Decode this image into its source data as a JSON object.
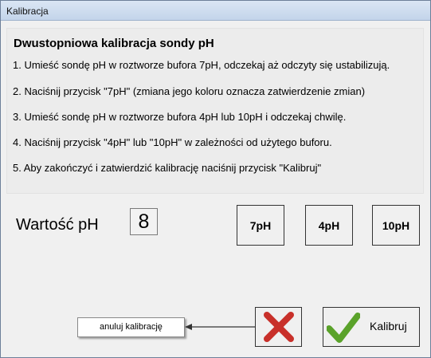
{
  "window": {
    "title": "Kalibracja"
  },
  "instructions": {
    "heading": "Dwustopniowa kalibracja sondy pH",
    "steps": [
      "1. Umieść sondę pH w roztworze bufora 7pH, odczekaj aż odczyty się ustabilizują.",
      "2. Naciśnij przycisk \"7pH\" (zmiana jego koloru oznacza zatwierdzenie zmian)",
      "3. Umieść sondę pH w roztworze bufora 4pH lub 10pH i odczekaj chwilę.",
      "4. Naciśnij przycisk \"4pH\" lub \"10pH\" w zależności od użytego buforu.",
      "5. Aby zakończyć i zatwierdzić kalibrację naciśnij przycisk \"Kalibruj\""
    ]
  },
  "ph": {
    "label": "Wartość pH",
    "value": "8"
  },
  "buttons": {
    "ph7": "7pH",
    "ph4": "4pH",
    "ph10": "10pH",
    "calibrate": "Kalibruj"
  },
  "cancel": {
    "hint": "anuluj kalibrację"
  },
  "colors": {
    "cancel_red": "#c8302a",
    "ok_green": "#5aa22a"
  }
}
